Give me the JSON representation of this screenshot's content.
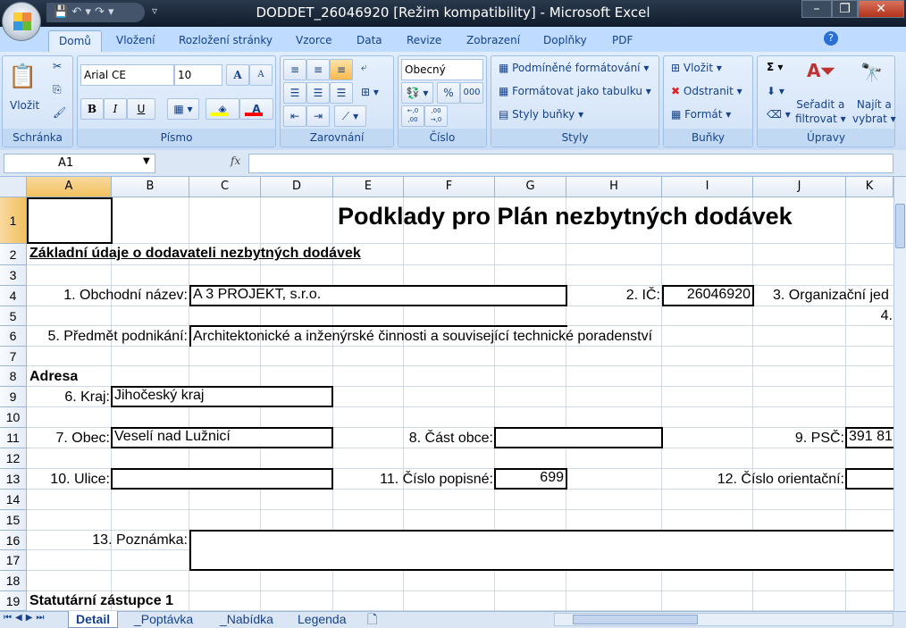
{
  "window": {
    "title": "DODDET_26046920  [Režim kompatibility] - Microsoft Excel",
    "minimize": "–",
    "restore": "❐",
    "close": "✕"
  },
  "qat": {
    "save": "💾",
    "undo": "↶ ▾",
    "redo": "↷ ▾",
    "customize": "▿"
  },
  "ribbon_tabs": [
    "Domů",
    "Vložení",
    "Rozložení stránky",
    "Vzorce",
    "Data",
    "Revize",
    "Zobrazení",
    "Doplňky",
    "PDF"
  ],
  "ribbon": {
    "clipboard": {
      "label": "Schránka",
      "paste": "Vložit"
    },
    "font": {
      "label": "Písmo",
      "font_name": "Arial CE",
      "font_size": "10",
      "bold": "B",
      "italic": "I",
      "underline": "U",
      "grow": "A",
      "shrink": "A",
      "fill_color": "#ffff00",
      "font_color": "#ff0000"
    },
    "alignment": {
      "label": "Zarovnání"
    },
    "number": {
      "label": "Číslo",
      "format": "Obecný",
      "percent": "%",
      "thousands": "000",
      "inc_dec": "←,0 ,00",
      "dec_dec": ",00 →,0"
    },
    "styles": {
      "label": "Styly",
      "conditional": "Podmíněné formátování",
      "as_table": "Formátovat jako tabulku",
      "cell_styles": "Styly buňky"
    },
    "cells": {
      "label": "Buňky",
      "insert": "Vložit",
      "delete": "Odstranit",
      "format": "Formát"
    },
    "editing": {
      "label": "Úpravy",
      "sum": "Σ",
      "sort_line1": "Seřadit a",
      "sort_line2": "filtrovat",
      "find_line1": "Najít a",
      "find_line2": "vybrat"
    }
  },
  "formula_bar": {
    "name_box": "A1",
    "fx": "fx",
    "formula": ""
  },
  "columns": [
    "A",
    "B",
    "C",
    "D",
    "E",
    "F",
    "G",
    "H",
    "I",
    "J",
    "K"
  ],
  "rows": [
    "1",
    "2",
    "3",
    "4",
    "5",
    "6",
    "7",
    "8",
    "9",
    "10",
    "11",
    "12",
    "13",
    "14",
    "15",
    "16",
    "17",
    "18",
    "19"
  ],
  "sheet": {
    "title": "Podklady pro Plán nezbytných dodávek",
    "section1": "Základní údaje o dodavateli nezbytných dodávek",
    "l_name": "1. Obchodní název:",
    "v_name": "A 3 PROJEKT, s.r.o.",
    "l_ic": "2. IČ:",
    "v_ic": "26046920",
    "l_org": "3. Organizační jed",
    "l_4": "4.",
    "l_subject": "5. Předmět podnikání:",
    "v_subject": "Architektonické a inženýrské činnosti a související technické poradenství",
    "section_address": "Adresa",
    "l_kraj": "6. Kraj:",
    "v_kraj": "Jihočeský kraj",
    "l_obec": "7. Obec:",
    "v_obec": "Veselí nad Lužnicí",
    "l_cast": "8. Část obce:",
    "v_cast": "",
    "l_psc": "9. PSČ:",
    "v_psc": "391 81",
    "l_ulice": "10. Ulice:",
    "v_ulice": "",
    "l_cp": "11. Číslo popisné:",
    "v_cp": "699",
    "l_co": "12. Číslo orientační:",
    "v_co": "",
    "l_note": "13. Poznámka:",
    "v_note": "",
    "section_stat": "Statutární zástupce 1"
  },
  "sheet_tabs": [
    "Detail",
    "_Poptávka",
    "_Nabídka",
    "Legenda"
  ],
  "active_sheet": "Detail"
}
